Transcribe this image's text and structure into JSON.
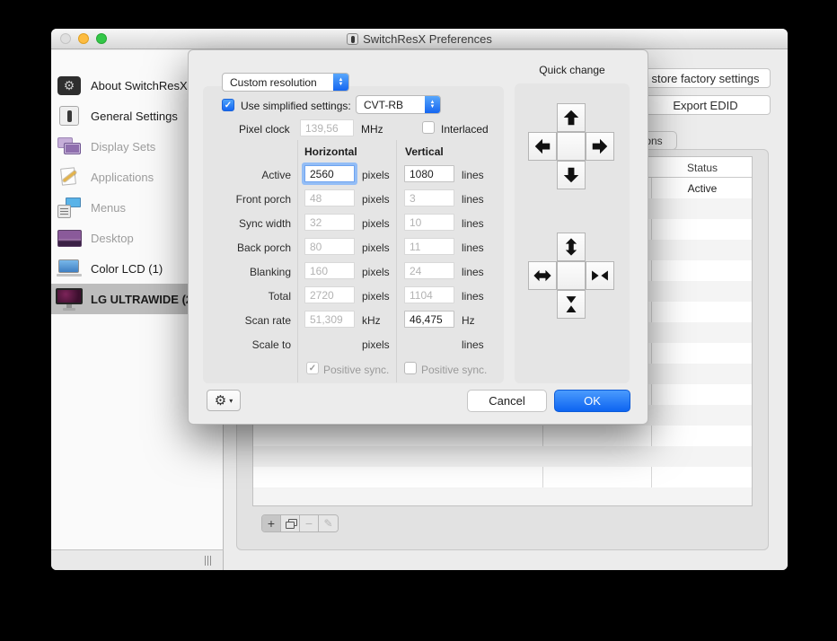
{
  "titlebar": {
    "title": "SwitchResX Preferences"
  },
  "sidebar": {
    "items": [
      {
        "label": "About SwitchResX",
        "enabled": true
      },
      {
        "label": "General Settings",
        "enabled": true
      },
      {
        "label": "Display Sets",
        "enabled": false
      },
      {
        "label": "Applications",
        "enabled": false
      },
      {
        "label": "Menus",
        "enabled": false
      },
      {
        "label": "Desktop",
        "enabled": false
      },
      {
        "label": "Color LCD (1)",
        "enabled": true
      },
      {
        "label": "LG ULTRAWIDE (2",
        "enabled": true,
        "selected": true
      }
    ]
  },
  "content": {
    "restore_button": "store factory settings",
    "export_button": "Export EDID",
    "tab_label": "ons",
    "table": {
      "status_header": "Status",
      "rows": [
        {
          "status": "Active"
        }
      ]
    },
    "toolbar": {
      "add": "+",
      "minus": "−"
    }
  },
  "dialog": {
    "preset_popup": "Custom resolution",
    "use_simplified_label": "Use simplified settings:",
    "timing_popup": "CVT-RB",
    "pixel_clock": {
      "label": "Pixel clock",
      "value": "139,56",
      "unit": "MHz"
    },
    "interlaced_label": "Interlaced",
    "headers": {
      "horizontal": "Horizontal",
      "vertical": "Vertical"
    },
    "rows": [
      {
        "label": "Active",
        "h": "2560",
        "hu": "pixels",
        "v": "1080",
        "vu": "lines"
      },
      {
        "label": "Front porch",
        "h": "48",
        "hu": "pixels",
        "v": "3",
        "vu": "lines"
      },
      {
        "label": "Sync width",
        "h": "32",
        "hu": "pixels",
        "v": "10",
        "vu": "lines"
      },
      {
        "label": "Back porch",
        "h": "80",
        "hu": "pixels",
        "v": "11",
        "vu": "lines"
      },
      {
        "label": "Blanking",
        "h": "160",
        "hu": "pixels",
        "v": "24",
        "vu": "lines"
      },
      {
        "label": "Total",
        "h": "2720",
        "hu": "pixels",
        "v": "1104",
        "vu": "lines"
      },
      {
        "label": "Scan rate",
        "h": "51,309",
        "hu": "kHz",
        "v": "46,475",
        "vu": "Hz"
      },
      {
        "label": "Scale to",
        "h": "",
        "hu": "pixels",
        "v": "",
        "vu": "lines"
      }
    ],
    "positive_sync": {
      "h_label": "Positive sync.",
      "v_label": "Positive sync."
    },
    "quick_change": {
      "title": "Quick change"
    },
    "buttons": {
      "cancel": "Cancel",
      "ok": "OK"
    },
    "check_glyph": "✓"
  },
  "colors": {
    "accent": "#2f7cf6",
    "selected_row": "#bdbdbd",
    "ok_blue": "#0d64f1"
  }
}
